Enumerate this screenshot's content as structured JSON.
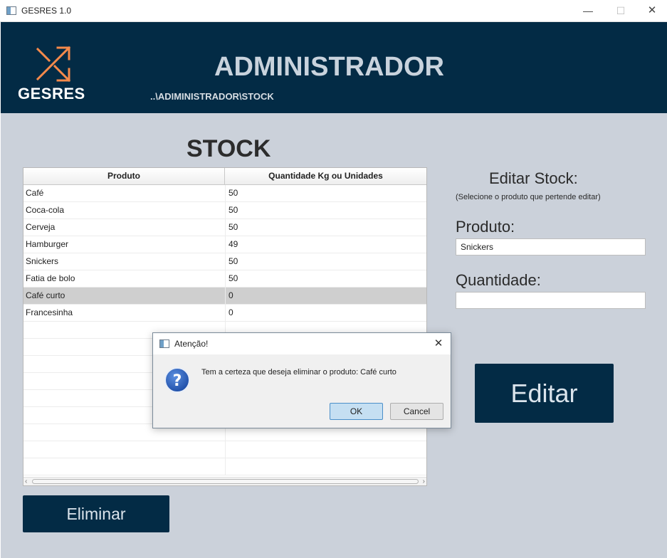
{
  "window": {
    "title": "GESRES 1.0",
    "minimize": "—",
    "maximize": "☐",
    "close": "✕"
  },
  "header": {
    "logo_text": "GESRES",
    "title": "ADMINISTRADOR",
    "breadcrumb": "..\\ADIMINISTRADOR\\STOCK"
  },
  "stock": {
    "title": "STOCK",
    "columns": [
      "Produto",
      "Quantidade Kg ou Unidades"
    ],
    "rows": [
      {
        "produto": "Café",
        "quantidade": "50"
      },
      {
        "produto": "Coca-cola",
        "quantidade": "50"
      },
      {
        "produto": "Cerveja",
        "quantidade": "50"
      },
      {
        "produto": "Hamburger",
        "quantidade": "49"
      },
      {
        "produto": "Snickers",
        "quantidade": "50"
      },
      {
        "produto": "Fatia de bolo",
        "quantidade": "50"
      },
      {
        "produto": "Café curto",
        "quantidade": "0"
      },
      {
        "produto": "Francesinha",
        "quantidade": "0"
      }
    ],
    "selected_row": 6,
    "eliminar_label": "Eliminar"
  },
  "edit": {
    "title": "Editar Stock:",
    "subtitle": "(Selecione o produto que pertende editar)",
    "produto_label": "Produto:",
    "produto_value": "Snickers",
    "quantidade_label": "Quantidade:",
    "quantidade_value": "",
    "editar_label": "Editar"
  },
  "dialog": {
    "title": "Atenção!",
    "close": "✕",
    "message": "Tem a certeza que deseja eliminar o produto: Café curto",
    "ok_label": "OK",
    "cancel_label": "Cancel"
  },
  "colors": {
    "header_bg": "#032b45",
    "content_bg": "#cbd1da",
    "accent": "#f58a4b"
  },
  "icons": {
    "logo": "arrows-logo-icon",
    "dialog": "question-icon"
  }
}
